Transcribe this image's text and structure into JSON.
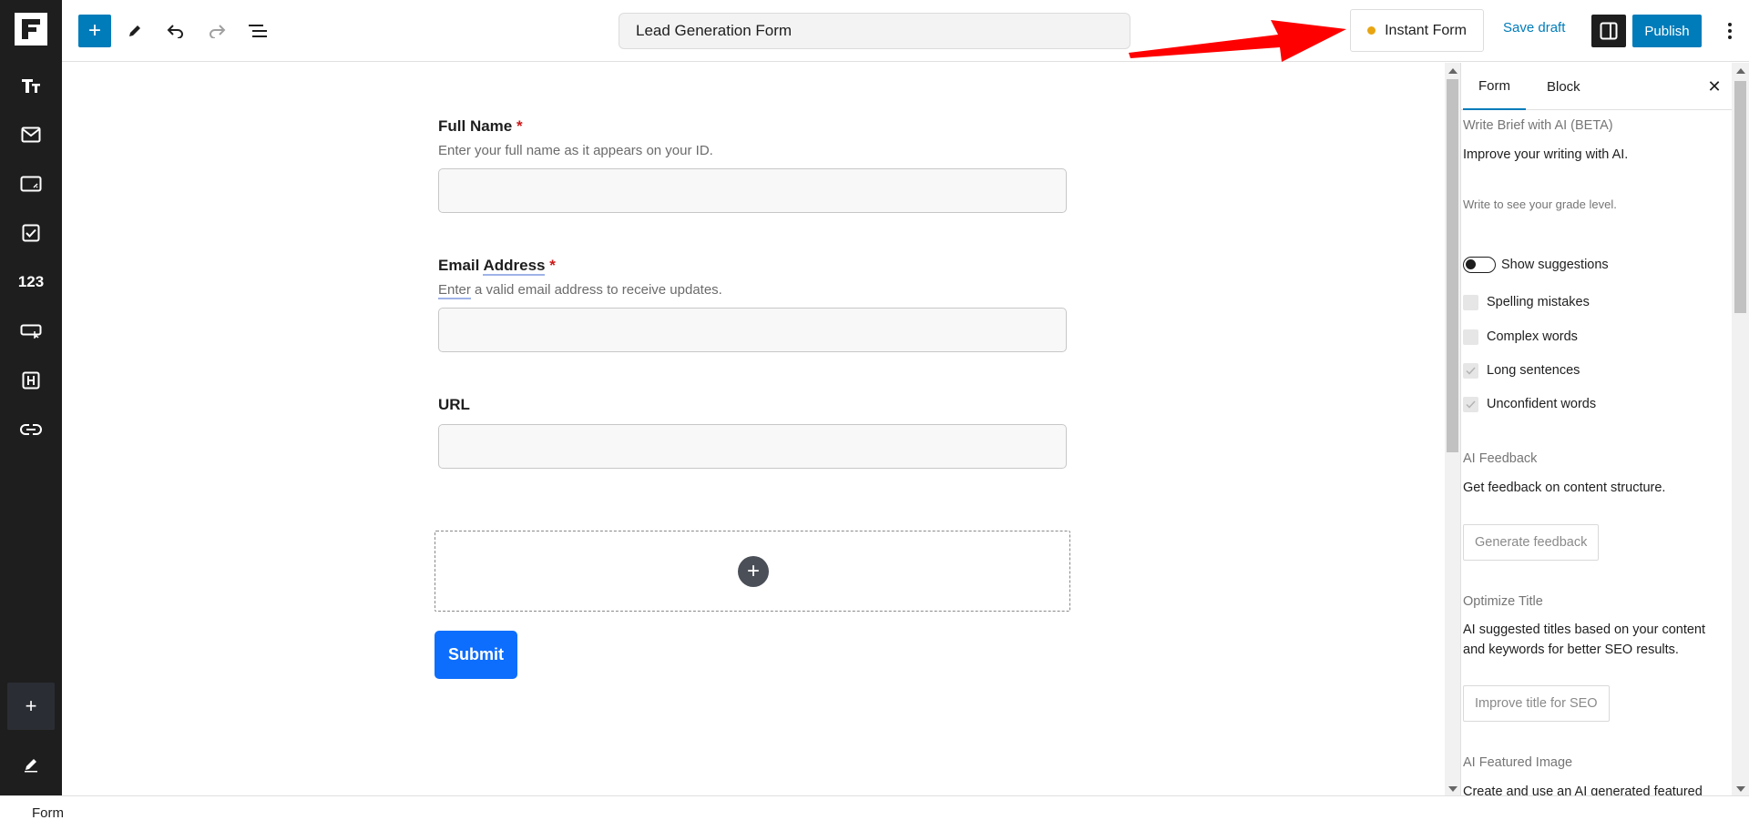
{
  "header": {
    "document_title": "Lead Generation Form",
    "instant_form_label": "Instant Form",
    "save_draft_label": "Save draft",
    "publish_label": "Publish"
  },
  "sidebar": {
    "numbers_label": "123"
  },
  "form": {
    "fields": [
      {
        "label": "Full Name",
        "required_mark": "*",
        "help": "Enter your full name as it appears on your ID."
      },
      {
        "label_part1": "Email ",
        "label_part2": "Address",
        "required_mark": "*",
        "help_part1": "Enter",
        "help_part2": " a valid email address to receive updates."
      },
      {
        "label": "URL"
      }
    ],
    "submit_label": "Submit"
  },
  "panel": {
    "tabs": [
      {
        "label": "Form",
        "active": true
      },
      {
        "label": "Block",
        "active": false
      }
    ],
    "write_brief_title": "Write Brief with AI (BETA)",
    "improve_text": "Improve your writing with AI.",
    "grade_text": "Write to see your grade level.",
    "show_suggestions_label": "Show suggestions",
    "checks": [
      {
        "label": "Spelling mistakes",
        "checked": false
      },
      {
        "label": "Complex words",
        "checked": false
      },
      {
        "label": "Long sentences",
        "checked": true
      },
      {
        "label": "Unconfident words",
        "checked": true
      }
    ],
    "ai_feedback_title": "AI Feedback",
    "ai_feedback_text": "Get feedback on content structure.",
    "generate_feedback_label": "Generate feedback",
    "optimize_title": "Optimize Title",
    "optimize_text_line1": "AI suggested titles based on your content",
    "optimize_text_line2": "and keywords for better SEO results.",
    "improve_title_label": "Improve title for SEO",
    "featured_image_title": "AI Featured Image",
    "featured_image_text": "Create and use an AI generated featured"
  },
  "footer": {
    "breadcrumb": "Form"
  },
  "colors": {
    "accent": "#007cba",
    "submit": "#0d6efd",
    "required": "#cc1818",
    "status_dot": "#e8a511",
    "annotation_arrow": "#ff0000"
  }
}
